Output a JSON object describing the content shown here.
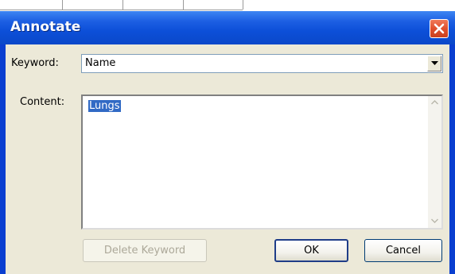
{
  "window": {
    "title": "Annotate"
  },
  "keyword": {
    "label": "Keyword:",
    "value": "Name"
  },
  "content": {
    "label": "Content:",
    "value": "Lungs"
  },
  "buttons": {
    "delete_keyword": "Delete Keyword",
    "ok": "OK",
    "cancel": "Cancel"
  },
  "icons": {
    "close": "close-icon",
    "dropdown": "chevron-down-icon",
    "scroll_up": "scroll-up-icon",
    "scroll_down": "scroll-down-icon"
  },
  "colors": {
    "titlebar": "#0c4fd8",
    "dialog_face": "#ece9d8",
    "selection": "#316ac5",
    "close_button": "#e0502e"
  }
}
